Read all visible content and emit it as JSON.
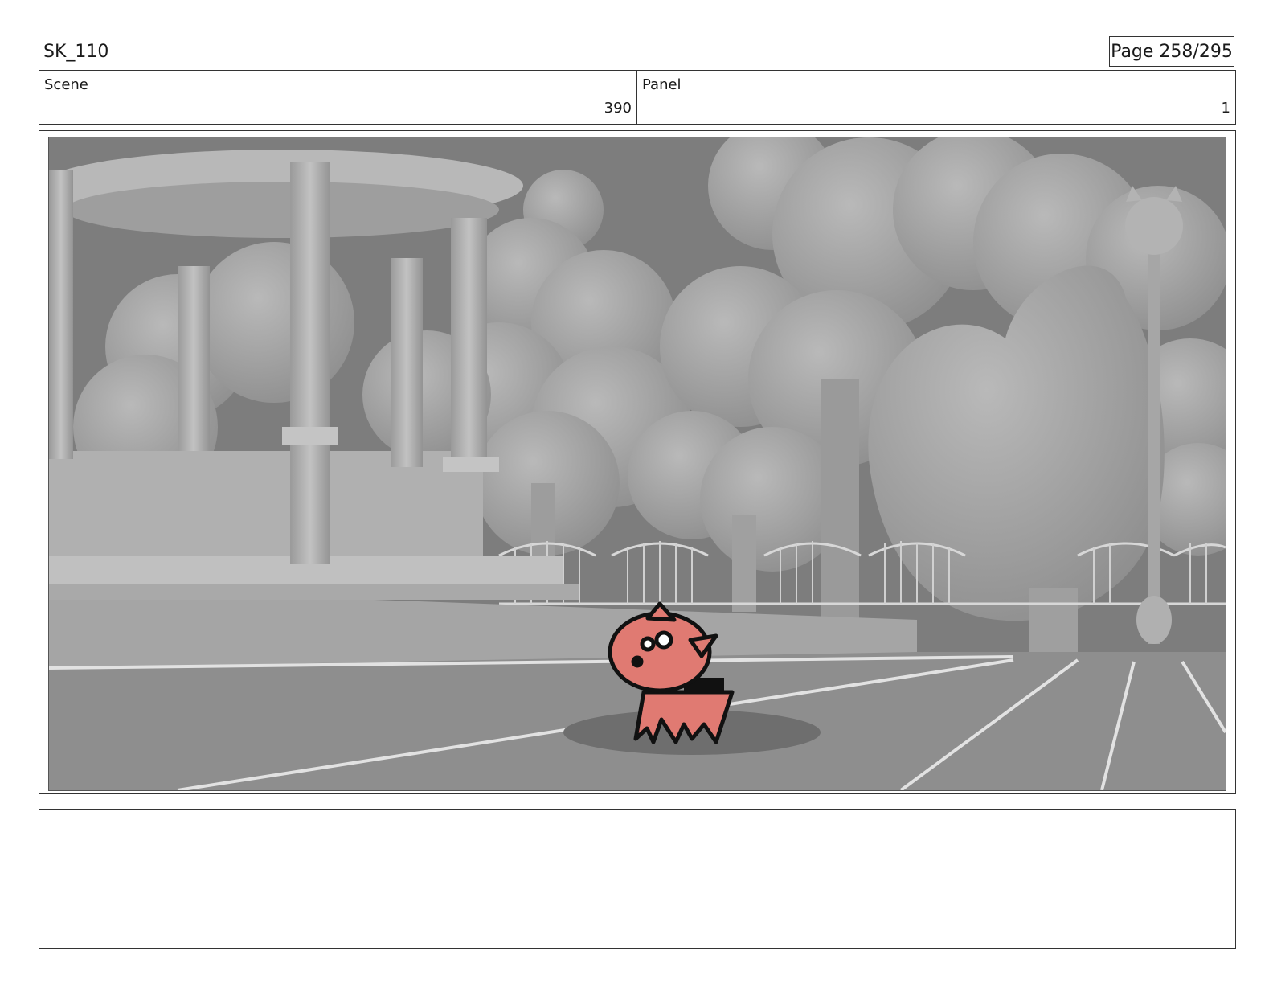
{
  "header": {
    "title": "SK_110",
    "page_label": "Page 258/295"
  },
  "info": {
    "scene_label": "Scene",
    "scene_value": "390",
    "panel_label": "Panel",
    "panel_value": "1"
  },
  "notes": {
    "text": ""
  },
  "colors": {
    "character": "#e07a72",
    "background": "#8a8a8a"
  }
}
